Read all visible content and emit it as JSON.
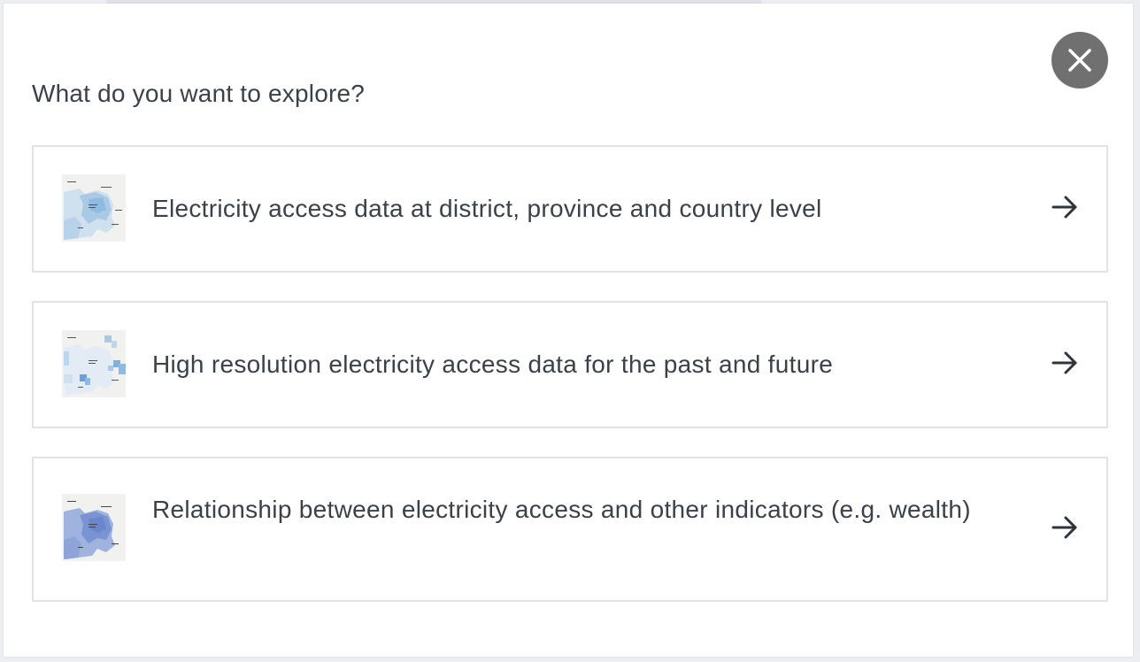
{
  "dialog": {
    "title": "What do you want to explore?",
    "close_icon": "close-icon",
    "close_color": "#707070"
  },
  "options": [
    {
      "label": "Electricity access data at district, province and country level",
      "thumbnail": "district-province-country-map-thumbnail",
      "arrow_icon": "arrow-right-icon"
    },
    {
      "label": "High resolution electricity access data for the past and future",
      "thumbnail": "high-resolution-map-thumbnail",
      "arrow_icon": "arrow-right-icon"
    },
    {
      "label": "Relationship between electricity access and other indicators (e.g. wealth)",
      "thumbnail": "relationship-map-thumbnail",
      "arrow_icon": "arrow-right-icon"
    }
  ],
  "colors": {
    "text": "#3b4148",
    "border": "#e3e3e3",
    "map_light": "#a9c9e4",
    "map_mid": "#7fb0de",
    "map_dark": "#6a86cc"
  }
}
